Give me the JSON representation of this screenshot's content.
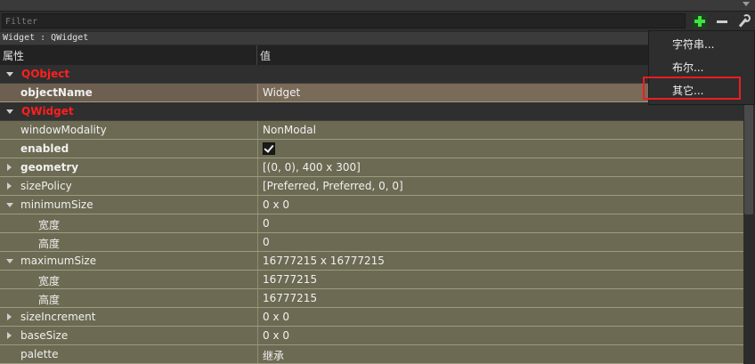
{
  "filter": {
    "placeholder": "Filter"
  },
  "class_bar": "Widget : QWidget",
  "header": {
    "property": "属性",
    "value": "值"
  },
  "rows": [
    {
      "type": "group",
      "name": "QObject",
      "expanded": true
    },
    {
      "type": "prop",
      "name": "objectName",
      "value": "Widget",
      "bold": true,
      "selected": true
    },
    {
      "type": "group",
      "name": "QWidget",
      "expanded": true
    },
    {
      "type": "prop",
      "name": "windowModality",
      "value": "NonModal"
    },
    {
      "type": "prop",
      "name": "enabled",
      "checked": true,
      "bold": true
    },
    {
      "type": "prop",
      "name": "geometry",
      "value": "[(0, 0), 400 x 300]",
      "bold": true,
      "expander": "collapsed"
    },
    {
      "type": "prop",
      "name": "sizePolicy",
      "value": "[Preferred, Preferred, 0, 0]",
      "expander": "collapsed"
    },
    {
      "type": "prop",
      "name": "minimumSize",
      "value": "0 x 0",
      "expander": "expanded"
    },
    {
      "type": "child",
      "name": "宽度",
      "value": "0"
    },
    {
      "type": "child",
      "name": "高度",
      "value": "0"
    },
    {
      "type": "prop",
      "name": "maximumSize",
      "value": "16777215 x 16777215",
      "expander": "expanded"
    },
    {
      "type": "child",
      "name": "宽度",
      "value": "16777215"
    },
    {
      "type": "child",
      "name": "高度",
      "value": "16777215"
    },
    {
      "type": "prop",
      "name": "sizeIncrement",
      "value": "0 x 0",
      "expander": "collapsed"
    },
    {
      "type": "prop",
      "name": "baseSize",
      "value": "0 x 0",
      "expander": "collapsed"
    },
    {
      "type": "prop",
      "name": "palette",
      "value": "继承"
    }
  ],
  "menu": {
    "items": [
      "字符串...",
      "布尔...",
      "其它..."
    ]
  },
  "colors": {
    "group_text": "#ff1f1f",
    "row_bg": "#6c6a52",
    "highlight": "#ee1c24",
    "add_icon": "#3fe33f"
  },
  "icons": {
    "add": "plus-icon",
    "remove": "minus-icon",
    "configure": "wrench-icon"
  }
}
